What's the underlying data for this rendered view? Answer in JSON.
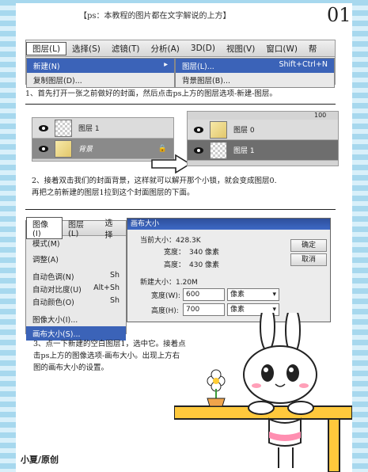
{
  "header": {
    "title": "【ps：本教程的图片都在文字解说的上方】",
    "page": "01"
  },
  "menubar1": {
    "items": [
      "图层(L)",
      "选择(S)",
      "滤镜(T)",
      "分析(A)",
      "3D(D)",
      "视图(V)",
      "窗口(W)",
      "帮"
    ]
  },
  "layer_menu": {
    "new": "新建(N)",
    "dup": "复制图层(D)..."
  },
  "new_submenu": {
    "layer": "图层(L)...",
    "shortcut": "Shift+Ctrl+N",
    "bg": "背景图层(B)..."
  },
  "step1": "1、首先打开一张之前做好的封面，然后点击ps上方的图层选项-新建-图层。",
  "layers_before": {
    "layer1": "图层 1",
    "bg": "背景"
  },
  "layers_after": {
    "layer0": "图层 0",
    "layer1": "图层 1",
    "opacity": "100"
  },
  "step2a": "2、接着双击我们的封面背景，这样就可以解开那个小锁，就会变成图层0.",
  "step2b": "再把之前新建的图层1拉到这个封面图层的下面。",
  "menubar2": {
    "items": [
      "图像(I)",
      "图层(L)",
      "选择"
    ]
  },
  "image_menu": {
    "items": [
      "模式(M)",
      "调整(A)",
      "自动色调(N)",
      "自动对比度(U)",
      "自动颜色(O)",
      "图像大小(I)...",
      "画布大小(S)..."
    ],
    "shortcuts": [
      "",
      "",
      "Sh",
      "Alt+Sh",
      "Sh",
      "",
      ""
    ]
  },
  "canvas_dialog": {
    "title": "画布大小",
    "current_size": "当前大小：428.3K",
    "width_label": "宽度：",
    "width": "340 像素",
    "height_label": "高度：",
    "height": "430 像素",
    "new_size": "新建大小：1.20M",
    "w_label": "宽度(W):",
    "w_value": "600",
    "h_label": "高度(H):",
    "h_value": "700",
    "unit": "像素",
    "ok": "确定",
    "cancel": "取消"
  },
  "step3": [
    "3、点一下新建的空白图层1，选中它。接着点",
    "击ps上方的图像选项-画布大小。出现上方右",
    "图的画布大小的设置。"
  ],
  "footer": {
    "author": "小夏/原创"
  }
}
